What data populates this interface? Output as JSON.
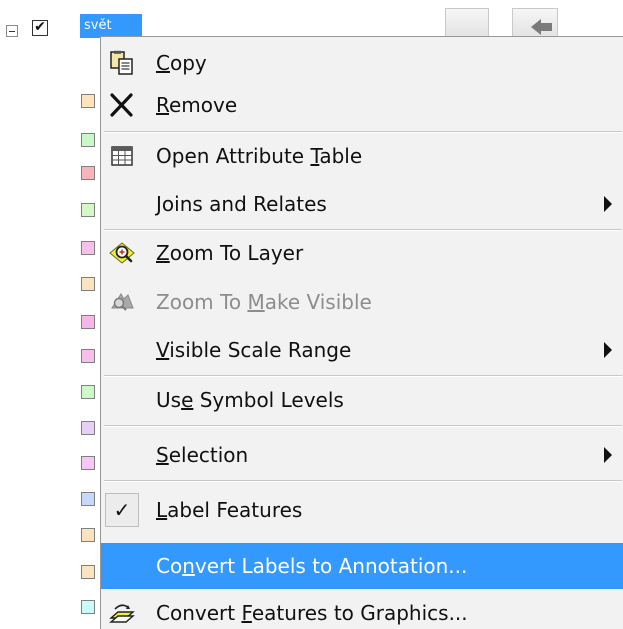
{
  "tree": {
    "layer_name": "svět",
    "layer_checked": "✔",
    "swatch_colors": [
      "#fce4bd",
      "#c9f7c7",
      "#f8b5b9",
      "#d6f8c6",
      "#f6bfec",
      "#fde3bd",
      "#f6b7e8",
      "#f6bfec",
      "#cff8cc",
      "#e8cff8",
      "#f3c7f7",
      "#c5d9f7",
      "#fde3bd",
      "#fde3bd",
      "#c9fbf8"
    ]
  },
  "menu": {
    "items": [
      {
        "id": "copy",
        "icon": "copy-icon",
        "pre": "",
        "key": "C",
        "post": "opy",
        "enabled": true,
        "submenu": false
      },
      {
        "id": "remove",
        "icon": "remove-icon",
        "pre": "",
        "key": "R",
        "post": "emove",
        "enabled": true,
        "submenu": false
      },
      {
        "id": "open-attribute-table",
        "icon": "attribute-table-icon",
        "pre": "Open Attribute ",
        "key": "T",
        "post": "able",
        "enabled": true,
        "submenu": false
      },
      {
        "id": "joins-and-relates",
        "icon": "",
        "pre": "",
        "key": "J",
        "post": "oins and Relates",
        "enabled": true,
        "submenu": true
      },
      {
        "id": "zoom-to-layer",
        "icon": "zoom-to-layer-icon",
        "pre": "",
        "key": "Z",
        "post": "oom To Layer",
        "enabled": true,
        "submenu": false
      },
      {
        "id": "zoom-to-make-visible",
        "icon": "zoom-to-make-visible-icon",
        "pre": "Zoom To ",
        "key": "M",
        "post": "ake Visible",
        "enabled": false,
        "submenu": false
      },
      {
        "id": "visible-scale-range",
        "icon": "",
        "pre": "",
        "key": "V",
        "post": "isible Scale Range",
        "enabled": true,
        "submenu": true
      },
      {
        "id": "use-symbol-levels",
        "icon": "",
        "pre": "Us",
        "key": "e",
        "post": " Symbol Levels",
        "enabled": true,
        "submenu": false
      },
      {
        "id": "selection",
        "icon": "",
        "pre": "",
        "key": "S",
        "post": "election",
        "enabled": true,
        "submenu": true
      },
      {
        "id": "label-features",
        "icon": "checkmark-icon",
        "pre": "",
        "key": "L",
        "post": "abel Features",
        "enabled": true,
        "submenu": false,
        "checked": true
      },
      {
        "id": "convert-labels-to-annotation",
        "icon": "",
        "pre": "Co",
        "key": "n",
        "post": "vert Labels to Annotation...",
        "enabled": true,
        "submenu": false,
        "highlighted": true
      },
      {
        "id": "convert-features-to-graphics",
        "icon": "convert-to-graphics-icon",
        "pre": "Convert ",
        "key": "F",
        "post": "eatures to Graphics...",
        "enabled": true,
        "submenu": false
      }
    ]
  },
  "colors": {
    "highlight": "#3399ff",
    "menu_bg": "#f2f2f2",
    "disabled_text": "#8d8d8d"
  }
}
